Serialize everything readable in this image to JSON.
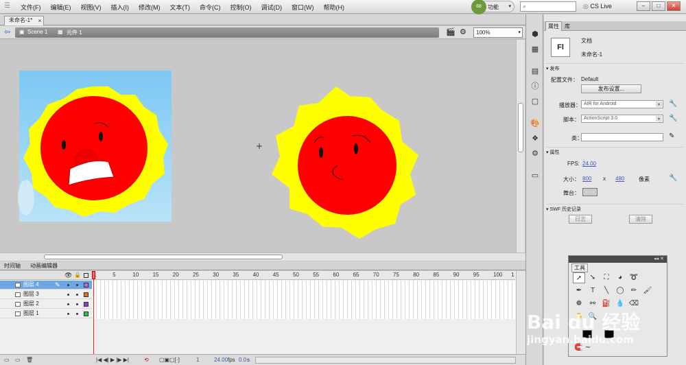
{
  "menu": {
    "items": [
      "文件(F)",
      "编辑(E)",
      "视图(V)",
      "插入(I)",
      "修改(M)",
      "文本(T)",
      "命令(C)",
      "控制(O)",
      "调试(D)",
      "窗口(W)",
      "帮助(H)"
    ],
    "workspace_badge": "68",
    "workspace_label": "功能",
    "cs_live": "CS Live",
    "win_min": "–",
    "win_max": "□",
    "win_close": "✕"
  },
  "doc": {
    "tab_title": "未命名-1*",
    "tab_close": "×",
    "crumb_scene": "Scene 1",
    "crumb_symbol": "元件 1",
    "zoom": "100%"
  },
  "timeline": {
    "tabs": [
      "时间轴",
      "动画编辑器"
    ],
    "ruler": [
      "1",
      "5",
      "10",
      "15",
      "20",
      "25",
      "30",
      "35",
      "40",
      "45",
      "50",
      "55",
      "60",
      "65",
      "70",
      "75",
      "80",
      "85",
      "90",
      "95",
      "100",
      "1"
    ],
    "layers": [
      {
        "name": "图层 4",
        "color": "#b86be0",
        "selected": true
      },
      {
        "name": "图层 3",
        "color": "#e07020",
        "selected": false
      },
      {
        "name": "图层 2",
        "color": "#9040c0",
        "selected": false
      },
      {
        "name": "图层 1",
        "color": "#30c040",
        "selected": false
      }
    ],
    "current_frame": "1",
    "fps": "24.00",
    "fps_unit": "fps",
    "elapsed": "0.0",
    "elapsed_unit": "s"
  },
  "props": {
    "tabs": [
      "属性",
      "库"
    ],
    "doc_type": "文档",
    "doc_name": "未命名-1",
    "fl_icon": "Fl",
    "publish": {
      "section": "发布",
      "profile_label": "配置文件：",
      "profile_value": "Default",
      "settings_button": "发布设置...",
      "player_label": "播放器：",
      "player_value": "AIR for Android",
      "script_label": "脚本：",
      "script_value": "ActionScript 3.0",
      "class_label": "类："
    },
    "properties": {
      "section": "属性",
      "fps_label": "FPS:",
      "fps_value": "24.00",
      "size_label": "大小：",
      "width": "800",
      "x": "x",
      "height": "480",
      "unit": "像素",
      "stage_label": "舞台："
    },
    "swf": {
      "section": "SWF 历史记录",
      "log_button": "日志",
      "clear_button": "清除"
    }
  },
  "tools": {
    "title": "工具"
  },
  "watermark": {
    "line1": "Bai du 经验",
    "line2": "jingyan.baidu.com"
  },
  "colors": {
    "sun_face": "#ff0000",
    "sun_rays": "#ffff00",
    "sky": "#7cc8f4",
    "stage_color": "#cccccc"
  }
}
